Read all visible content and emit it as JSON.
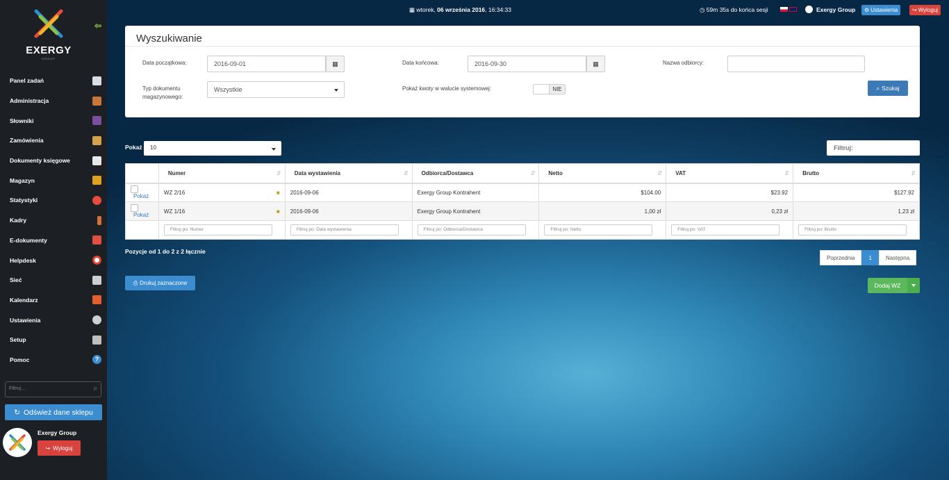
{
  "topbar": {
    "date_prefix": "wtorek, ",
    "date_main": "06 września 2016",
    "time": ", 16:34:33",
    "session": "59m 35s  do końca sesji",
    "company": "Exergy Group",
    "settings_label": "Ustawienia",
    "logout_label": "Wyloguj"
  },
  "sidebar": {
    "logo_text": "EXERGY",
    "logo_sub": "GROUP",
    "items": [
      {
        "label": "Panel zadań",
        "icon": "home-icon",
        "color": "#d8dde6"
      },
      {
        "label": "Administracja",
        "icon": "books-icon",
        "color": "#c8783a"
      },
      {
        "label": "Słowniki",
        "icon": "book-icon",
        "color": "#7a4f9e"
      },
      {
        "label": "Zamówienia",
        "icon": "package-icon",
        "color": "#d4a24a"
      },
      {
        "label": "Dokumenty księgowe",
        "icon": "document-icon",
        "color": "#e8e8e8"
      },
      {
        "label": "Magazyn",
        "icon": "forklift-icon",
        "color": "#e0a020"
      },
      {
        "label": "Statystyki",
        "icon": "pie-chart-icon",
        "color": "#e84c3d"
      },
      {
        "label": "Kadry",
        "icon": "person-icon",
        "color": "#d0703a"
      },
      {
        "label": "E-dokumenty",
        "icon": "pdf-icon",
        "color": "#e05040"
      },
      {
        "label": "Helpdesk",
        "icon": "lifebuoy-icon",
        "color": "#e04030"
      },
      {
        "label": "Sieć",
        "icon": "network-icon",
        "color": "#cfcfcf"
      },
      {
        "label": "Kalendarz",
        "icon": "calendar-icon",
        "color": "#e06030"
      },
      {
        "label": "Ustawienia",
        "icon": "gear-icon",
        "color": "#d0d0d0"
      },
      {
        "label": "Setup",
        "icon": "setup-icon",
        "color": "#c0c0c0"
      },
      {
        "label": "Pomoc",
        "icon": "help-icon",
        "color": "#3c8dcf"
      }
    ],
    "filter_placeholder": "Filtruj...",
    "refresh_label": "Odśwież dane sklepu",
    "user_name": "Exergy Group",
    "logout_label": "Wyloguj"
  },
  "search_panel": {
    "title": "Wyszukiwanie",
    "date_from_label": "Data początkowa:",
    "date_from_value": "2016-09-01",
    "date_to_label": "Data końcowa:",
    "date_to_value": "2016-09-30",
    "recipient_label": "Nazwa odbiorcy:",
    "recipient_value": "",
    "doc_type_label_1": "Typ dokumentu",
    "doc_type_label_2": "magazynowego:",
    "doc_type_value": "Wszystkie",
    "system_currency_label": "Pokaż kwoty w walucie systemowej:",
    "system_currency_value": "NIE",
    "search_button": "Szukaj"
  },
  "list_controls": {
    "show_label": "Pokaż",
    "show_value": "10",
    "filter_placeholder": "Filtruj:"
  },
  "table": {
    "headers": [
      "Numer",
      "Data wystawienia",
      "Odbiorca/Dostawca",
      "Netto",
      "VAT",
      "Brutto"
    ],
    "rows": [
      {
        "link": "Pokaż",
        "number": "WZ 2/16",
        "date": "2016-09-06",
        "party": "Exergy Group Kontrahent",
        "net": "$104.00",
        "vat": "$23.92",
        "gross": "$127.92"
      },
      {
        "link": "Pokaż",
        "number": "WZ 1/16",
        "date": "2016-09-06",
        "party": "Exergy Group Kontrahent",
        "net": "1,00 zł",
        "vat": "0,23 zł",
        "gross": "1,23 zł"
      }
    ],
    "filters": [
      "Filtruj po: Numer",
      "Filtruj po: Data wystawienia",
      "Filtruj po: Odbiorca/Dostawca",
      "Filtruj po: Netto",
      "Filtruj po: VAT",
      "Filtruj po: Brutto"
    ]
  },
  "footer": {
    "positions": "Pozycje od 1 do 2 z 2 łącznie",
    "prev_label": "Poprzednia",
    "page": "1",
    "next_label": "Następna",
    "print_label": "Drukuj zaznaczone",
    "add_label": "Dodaj WZ"
  }
}
